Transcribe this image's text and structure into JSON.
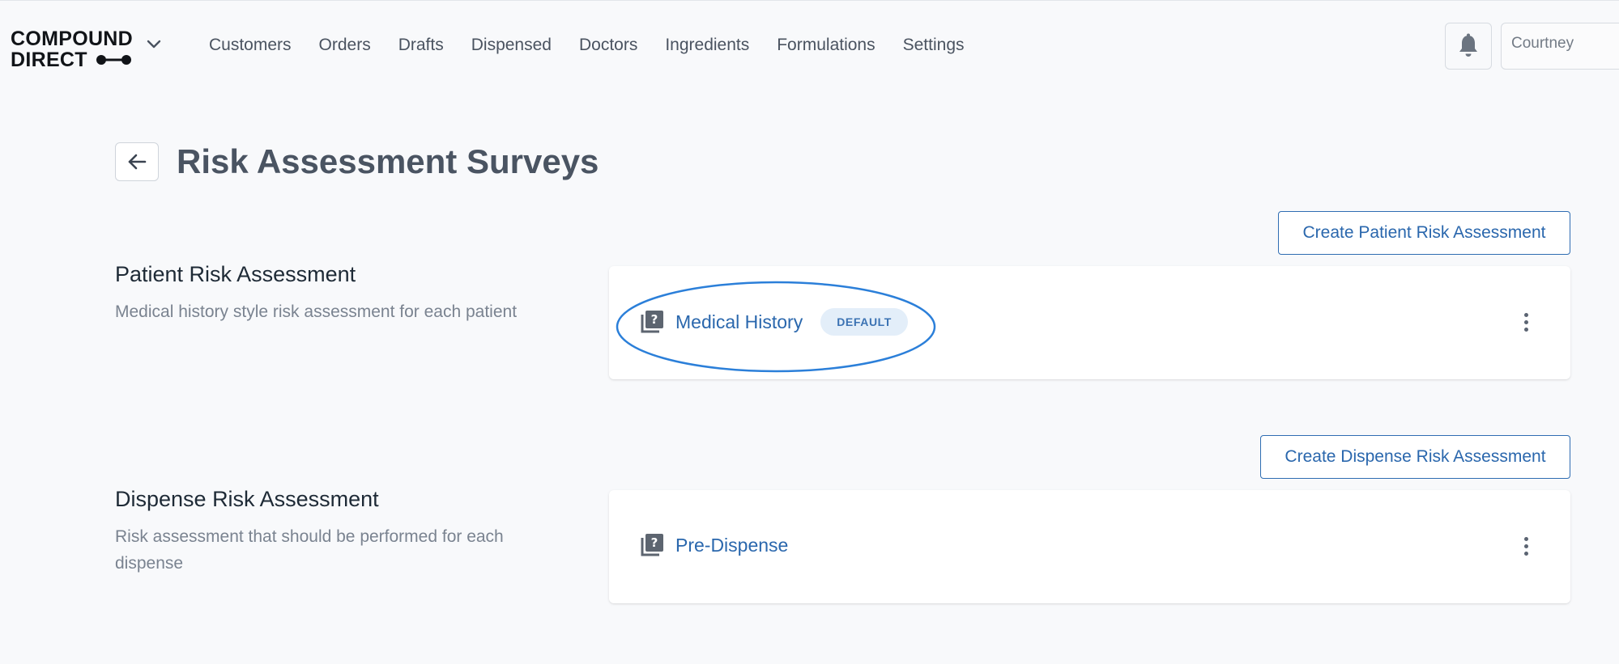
{
  "app": {
    "logo_line1": "COMPOUND",
    "logo_line2": "DIRECT"
  },
  "nav": {
    "items": [
      {
        "label": "Customers"
      },
      {
        "label": "Orders"
      },
      {
        "label": "Drafts"
      },
      {
        "label": "Dispensed"
      },
      {
        "label": "Doctors"
      },
      {
        "label": "Ingredients"
      },
      {
        "label": "Formulations"
      },
      {
        "label": "Settings"
      }
    ]
  },
  "header": {
    "user_name": "Courtney",
    "icons": [
      "bell-icon",
      "chevron-down-icon"
    ]
  },
  "page": {
    "title": "Risk Assessment Surveys",
    "back_icon": "arrow-left-icon"
  },
  "sections": {
    "patient": {
      "title": "Patient Risk Assessment",
      "description": "Medical history style risk assessment for each patient",
      "create_button": "Create Patient Risk Assessment",
      "survey": {
        "name": "Medical History",
        "badge": "DEFAULT",
        "icon": "quiz-icon"
      }
    },
    "dispense": {
      "title": "Dispense Risk Assessment",
      "description": "Risk assessment that should be performed for each dispense",
      "create_button": "Create Dispense Risk Assessment",
      "survey": {
        "name": "Pre-Dispense",
        "icon": "quiz-icon"
      }
    }
  },
  "colors": {
    "accent": "#2a67ad",
    "highlight": "#2b7fd9",
    "badge_bg": "#e3eef9",
    "page_bg": "#f8f9fb"
  }
}
